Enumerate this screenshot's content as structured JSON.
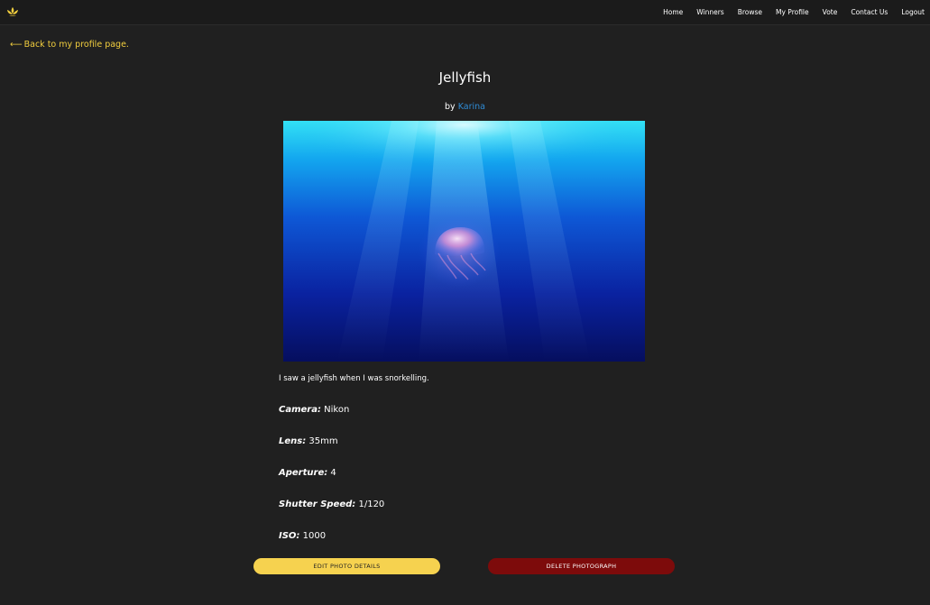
{
  "nav": {
    "items": [
      "Home",
      "Winners",
      "Browse",
      "My Profile",
      "Vote",
      "Contact Us",
      "Logout"
    ]
  },
  "back_link": {
    "arrow": "⟵",
    "label": "Back to my profile page."
  },
  "photo": {
    "title": "Jellyfish",
    "by_prefix": "by",
    "author": "Karina",
    "description": "I saw a jellyfish when I was snorkelling.",
    "details": [
      {
        "label": "Camera:",
        "value": "Nikon"
      },
      {
        "label": "Lens:",
        "value": "35mm"
      },
      {
        "label": "Aperture:",
        "value": "4"
      },
      {
        "label": "Shutter Speed:",
        "value": "1/120"
      },
      {
        "label": "ISO:",
        "value": "1000"
      }
    ]
  },
  "actions": {
    "edit_label": "EDIT PHOTO DETAILS",
    "delete_label": "DELETE PHOTOGRAPH"
  },
  "colors": {
    "accent": "#f2ce3e",
    "link": "#2f8bd4",
    "danger": "#7d0b0b",
    "background": "#202020"
  },
  "icons": {
    "logo": "lotus-logo-icon",
    "back": "arrow-left-icon"
  }
}
